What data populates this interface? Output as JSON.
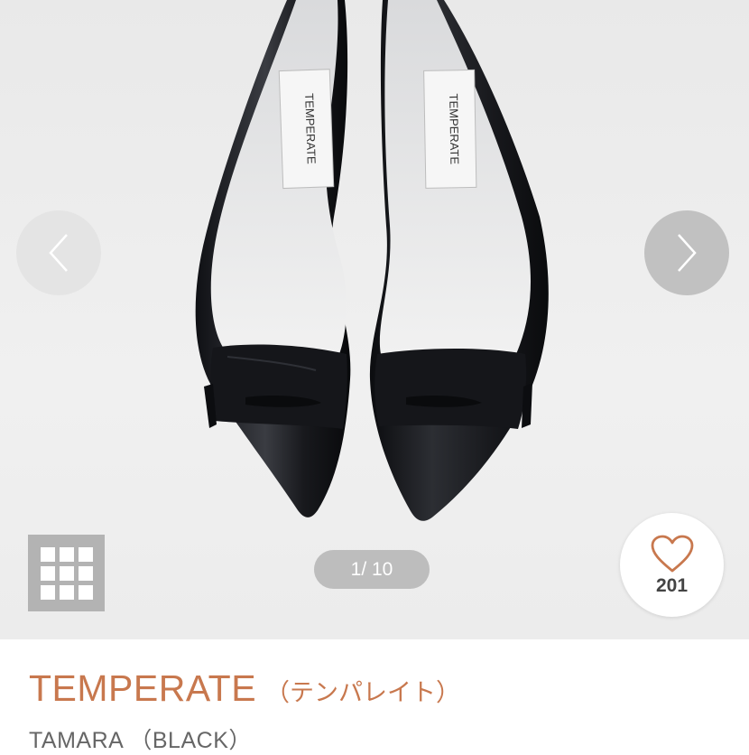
{
  "gallery": {
    "counter": "1/ 10",
    "tag_label": "TEMPERATE",
    "prev_icon": "chevron-left-icon",
    "next_icon": "chevron-right-icon",
    "grid_icon": "grid-icon"
  },
  "like": {
    "count": "201",
    "icon": "heart-icon"
  },
  "product": {
    "brand": "TEMPERATE",
    "brand_kana": "（テンパレイト）",
    "name": "TAMARA （BLACK）"
  },
  "colors": {
    "brand": "#c8784e",
    "heart": "#c8784e"
  }
}
